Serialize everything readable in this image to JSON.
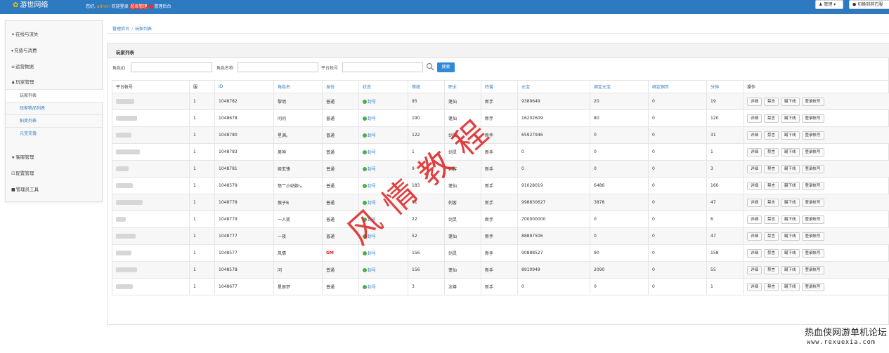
{
  "app": {
    "logo_text": "游世网络",
    "welcome_prefix": "您好,",
    "username": "admin",
    "welcome_suffix": "欢迎登录",
    "role_badge": "超级管理",
    "system_name": "管理后台"
  },
  "topbar": {
    "manage_label": "管理",
    "switch_label": "切换到其它服"
  },
  "sidebar": {
    "items": [
      {
        "label": "在线与流失",
        "icon": "star-icon"
      },
      {
        "label": "充值与消费",
        "icon": "cart-icon"
      },
      {
        "label": "运营数据",
        "icon": "list-icon"
      },
      {
        "label": "玩家管理",
        "icon": "user-icon"
      },
      {
        "label": "客服管理",
        "icon": "star-icon"
      },
      {
        "label": "配置管理",
        "icon": "check-icon"
      },
      {
        "label": "管理员工具",
        "icon": "lock-icon"
      }
    ],
    "subitems": [
      {
        "label": "玩家列表",
        "active": true
      },
      {
        "label": "玩家物品列表",
        "active": false
      },
      {
        "label": "拍卖列表",
        "active": false
      },
      {
        "label": "元宝充值",
        "active": false
      }
    ]
  },
  "breadcrumb": {
    "home": "管理后台",
    "separator": "/",
    "current": "玩家列表"
  },
  "panel": {
    "title": "玩家列表"
  },
  "filters": {
    "role_id_label": "角色ID",
    "role_name_label": "角色名称",
    "platform_account_label": "平台帐号",
    "search_button": "搜索"
  },
  "table": {
    "columns": [
      "平台帐号",
      "服",
      "ID",
      "角色名",
      "身份",
      "状态",
      "等级",
      "职业",
      "阵营",
      "元宝",
      "绑定元宝",
      "绑定铜币",
      "分钟",
      "操作"
    ],
    "actions": [
      "详细",
      "禁言",
      "踢下线",
      "登录帐号"
    ],
    "rows": [
      {
        "account": "",
        "server": "1",
        "id": "1048782",
        "name": "黎明",
        "identity": "普通",
        "status": "封号",
        "level": "95",
        "job": "蓬仙",
        "camp": "新手",
        "yuanbao": "9389649",
        "bound_yuanbao": "20",
        "bound_copper": "0",
        "minutes": "19"
      },
      {
        "account": "",
        "server": "1",
        "id": "1048678",
        "name": "问问",
        "identity": "普通",
        "status": "封号",
        "level": "190",
        "job": "蓬仙",
        "camp": "新手",
        "yuanbao": "16202609",
        "bound_yuanbao": "80",
        "bound_copper": "0",
        "minutes": "120"
      },
      {
        "account": "",
        "server": "1",
        "id": "1048780",
        "name": "星渊。",
        "identity": "普通",
        "status": "封号",
        "level": "122",
        "job": "剑灵",
        "camp": "新手",
        "yuanbao": "65927946",
        "bound_yuanbao": "0",
        "bound_copper": "0",
        "minutes": "31"
      },
      {
        "account": "",
        "server": "1",
        "id": "1048783",
        "name": "男神",
        "identity": "普通",
        "status": "封号",
        "level": "1",
        "job": "剑灵",
        "camp": "新手",
        "yuanbao": "0",
        "bound_yuanbao": "0",
        "bound_copper": "0",
        "minutes": "1"
      },
      {
        "account": "",
        "server": "1",
        "id": "1048781",
        "name": "姬玄锋",
        "identity": "普通",
        "status": "封号",
        "level": "9",
        "job": "刺客",
        "camp": "新手",
        "yuanbao": "0",
        "bound_yuanbao": "0",
        "bound_copper": "0",
        "minutes": "3"
      },
      {
        "account": "",
        "server": "1",
        "id": "1048579",
        "name": "怒艹小姑娘↘",
        "identity": "普通",
        "status": "封号",
        "level": "183",
        "job": "蓬仙",
        "camp": "新手",
        "yuanbao": "91028019",
        "bound_yuanbao": "6486",
        "bound_copper": "0",
        "minutes": "160"
      },
      {
        "account": "",
        "server": "1",
        "id": "1048778",
        "name": "猴子B",
        "identity": "普通",
        "status": "封号",
        "level": "51",
        "job": "刺客",
        "camp": "新手",
        "yuanbao": "998830627",
        "bound_yuanbao": "3878",
        "bound_copper": "0",
        "minutes": "47"
      },
      {
        "account": "",
        "server": "1",
        "id": "1048779",
        "name": "一人笑",
        "identity": "普通",
        "status": "封号",
        "level": "22",
        "job": "剑灵",
        "camp": "新手",
        "yuanbao": "700000000",
        "bound_yuanbao": "0",
        "bound_copper": "0",
        "minutes": "6"
      },
      {
        "account": "",
        "server": "1",
        "id": "1048777",
        "name": "一夜",
        "identity": "普通",
        "status": "封号",
        "level": "52",
        "job": "蓬仙",
        "camp": "新手",
        "yuanbao": "88897506",
        "bound_yuanbao": "0",
        "bound_copper": "0",
        "minutes": "47"
      },
      {
        "account": "",
        "server": "1",
        "id": "1048577",
        "name": "风情",
        "identity": "GM",
        "status": "封号",
        "level": "156",
        "job": "剑灵",
        "camp": "新手",
        "yuanbao": "90888527",
        "bound_yuanbao": "90",
        "bound_copper": "0",
        "minutes": "158"
      },
      {
        "account": "",
        "server": "1",
        "id": "1048578",
        "name": "问",
        "identity": "普通",
        "status": "封号",
        "level": "156",
        "job": "蓬仙",
        "camp": "新手",
        "yuanbao": "8910949",
        "bound_yuanbao": "2090",
        "bound_copper": "0",
        "minutes": "55"
      },
      {
        "account": "",
        "server": "1",
        "id": "1048677",
        "name": "星辰梦",
        "identity": "普通",
        "status": "封号",
        "level": "3",
        "job": "法尊",
        "camp": "新手",
        "yuanbao": "0",
        "bound_yuanbao": "0",
        "bound_copper": "0",
        "minutes": "1"
      }
    ]
  },
  "watermarks": {
    "overlay_text": "风情教程",
    "forum_name": "热血侠网游单机论坛",
    "forum_url": "www.rexuexia.com"
  },
  "colors": {
    "topbar": "#2e7ac0",
    "link": "#2e7ac0",
    "gm": "#e02020",
    "status_dot": "#48b04c",
    "watermark": "#dc1e1e"
  }
}
